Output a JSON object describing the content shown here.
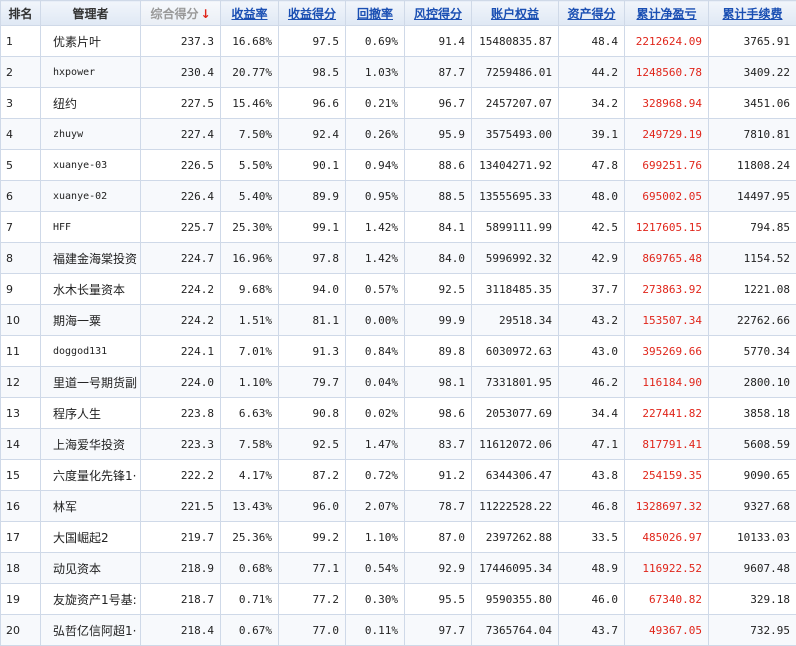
{
  "headers": [
    {
      "label": "排名",
      "kind": "plain"
    },
    {
      "label": "管理者",
      "kind": "plain"
    },
    {
      "label": "综合得分",
      "kind": "sorted",
      "arrow": "↓"
    },
    {
      "label": "收益率",
      "kind": "link"
    },
    {
      "label": "收益得分",
      "kind": "link"
    },
    {
      "label": "回撤率",
      "kind": "link"
    },
    {
      "label": "风控得分",
      "kind": "link"
    },
    {
      "label": "账户权益",
      "kind": "link"
    },
    {
      "label": "资产得分",
      "kind": "link"
    },
    {
      "label": "累计净盈亏",
      "kind": "link"
    },
    {
      "label": "累计手续费",
      "kind": "link"
    }
  ],
  "rows": [
    [
      "1",
      "优素片叶",
      "237.3",
      "16.68%",
      "97.5",
      "0.69%",
      "91.4",
      "15480835.87",
      "48.4",
      "2212624.09",
      "3765.91"
    ],
    [
      "2",
      "hxpower",
      "230.4",
      "20.77%",
      "98.5",
      "1.03%",
      "87.7",
      "7259486.01",
      "44.2",
      "1248560.78",
      "3409.22"
    ],
    [
      "3",
      "纽约",
      "227.5",
      "15.46%",
      "96.6",
      "0.21%",
      "96.7",
      "2457207.07",
      "34.2",
      "328968.94",
      "3451.06"
    ],
    [
      "4",
      "zhuyw",
      "227.4",
      "7.50%",
      "92.4",
      "0.26%",
      "95.9",
      "3575493.00",
      "39.1",
      "249729.19",
      "7810.81"
    ],
    [
      "5",
      "xuanye-03",
      "226.5",
      "5.50%",
      "90.1",
      "0.94%",
      "88.6",
      "13404271.92",
      "47.8",
      "699251.76",
      "11808.24"
    ],
    [
      "6",
      "xuanye-02",
      "226.4",
      "5.40%",
      "89.9",
      "0.95%",
      "88.5",
      "13555695.33",
      "48.0",
      "695002.05",
      "14497.95"
    ],
    [
      "7",
      "HFF",
      "225.7",
      "25.30%",
      "99.1",
      "1.42%",
      "84.1",
      "5899111.99",
      "42.5",
      "1217605.15",
      "794.85"
    ],
    [
      "8",
      "福建金海棠投资",
      "224.7",
      "16.96%",
      "97.8",
      "1.42%",
      "84.0",
      "5996992.32",
      "42.9",
      "869765.48",
      "1154.52"
    ],
    [
      "9",
      "水木长量资本",
      "224.2",
      "9.68%",
      "94.0",
      "0.57%",
      "92.5",
      "3118485.35",
      "37.7",
      "273863.92",
      "1221.08"
    ],
    [
      "10",
      "期海一粟",
      "224.2",
      "1.51%",
      "81.1",
      "0.00%",
      "99.9",
      "29518.34",
      "43.2",
      "153507.34",
      "22762.66"
    ],
    [
      "11",
      "doggod131",
      "224.1",
      "7.01%",
      "91.3",
      "0.84%",
      "89.8",
      "6030972.63",
      "43.0",
      "395269.66",
      "5770.34"
    ],
    [
      "12",
      "里道一号期货副",
      "224.0",
      "1.10%",
      "79.7",
      "0.04%",
      "98.1",
      "7331801.95",
      "46.2",
      "116184.90",
      "2800.10"
    ],
    [
      "13",
      "程序人生",
      "223.8",
      "6.63%",
      "90.8",
      "0.02%",
      "98.6",
      "2053077.69",
      "34.4",
      "227441.82",
      "3858.18"
    ],
    [
      "14",
      "上海爱华投资",
      "223.3",
      "7.58%",
      "92.5",
      "1.47%",
      "83.7",
      "11612072.06",
      "47.1",
      "817791.41",
      "5608.59"
    ],
    [
      "15",
      "六度量化先锋1·",
      "222.2",
      "4.17%",
      "87.2",
      "0.72%",
      "91.2",
      "6344306.47",
      "43.8",
      "254159.35",
      "9090.65"
    ],
    [
      "16",
      "林军",
      "221.5",
      "13.43%",
      "96.0",
      "2.07%",
      "78.7",
      "11222528.22",
      "46.8",
      "1328697.32",
      "9327.68"
    ],
    [
      "17",
      "大国崛起2",
      "219.7",
      "25.36%",
      "99.2",
      "1.10%",
      "87.0",
      "2397262.88",
      "33.5",
      "485026.97",
      "10133.03"
    ],
    [
      "18",
      "动见资本",
      "218.9",
      "0.68%",
      "77.1",
      "0.54%",
      "92.9",
      "17446095.34",
      "48.9",
      "116922.52",
      "9607.48"
    ],
    [
      "19",
      "友旋资产1号基:",
      "218.7",
      "0.71%",
      "77.2",
      "0.30%",
      "95.5",
      "9590355.80",
      "46.0",
      "67340.82",
      "329.18"
    ],
    [
      "20",
      "弘哲亿信阿超1·",
      "218.4",
      "0.67%",
      "77.0",
      "0.11%",
      "97.7",
      "7365764.04",
      "43.7",
      "49367.05",
      "732.95"
    ]
  ],
  "colors": {
    "link": "#1a4fb3",
    "loss_profit_red": "#e0251a",
    "border": "#cfd9e8",
    "header_bg": "#e6edf7"
  }
}
